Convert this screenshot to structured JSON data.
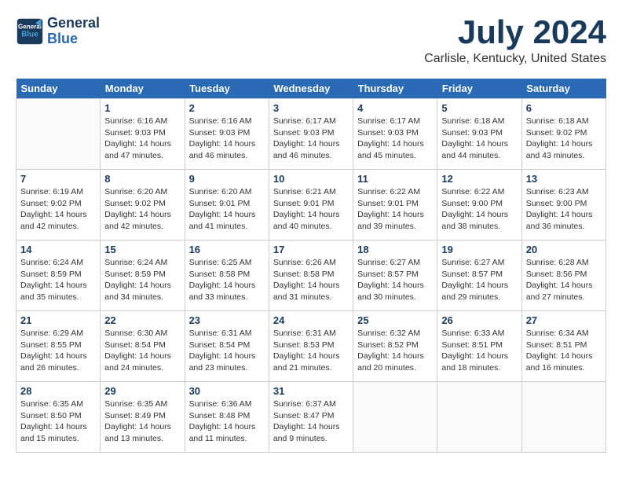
{
  "header": {
    "logo_line1": "General",
    "logo_line2": "Blue",
    "month_title": "July 2024",
    "location": "Carlisle, Kentucky, United States"
  },
  "days_of_week": [
    "Sunday",
    "Monday",
    "Tuesday",
    "Wednesday",
    "Thursday",
    "Friday",
    "Saturday"
  ],
  "weeks": [
    [
      {
        "date": "",
        "sunrise": "",
        "sunset": "",
        "daylight": ""
      },
      {
        "date": "1",
        "sunrise": "Sunrise: 6:16 AM",
        "sunset": "Sunset: 9:03 PM",
        "daylight": "Daylight: 14 hours and 47 minutes."
      },
      {
        "date": "2",
        "sunrise": "Sunrise: 6:16 AM",
        "sunset": "Sunset: 9:03 PM",
        "daylight": "Daylight: 14 hours and 46 minutes."
      },
      {
        "date": "3",
        "sunrise": "Sunrise: 6:17 AM",
        "sunset": "Sunset: 9:03 PM",
        "daylight": "Daylight: 14 hours and 46 minutes."
      },
      {
        "date": "4",
        "sunrise": "Sunrise: 6:17 AM",
        "sunset": "Sunset: 9:03 PM",
        "daylight": "Daylight: 14 hours and 45 minutes."
      },
      {
        "date": "5",
        "sunrise": "Sunrise: 6:18 AM",
        "sunset": "Sunset: 9:03 PM",
        "daylight": "Daylight: 14 hours and 44 minutes."
      },
      {
        "date": "6",
        "sunrise": "Sunrise: 6:18 AM",
        "sunset": "Sunset: 9:02 PM",
        "daylight": "Daylight: 14 hours and 43 minutes."
      }
    ],
    [
      {
        "date": "7",
        "sunrise": "Sunrise: 6:19 AM",
        "sunset": "Sunset: 9:02 PM",
        "daylight": "Daylight: 14 hours and 42 minutes."
      },
      {
        "date": "8",
        "sunrise": "Sunrise: 6:20 AM",
        "sunset": "Sunset: 9:02 PM",
        "daylight": "Daylight: 14 hours and 42 minutes."
      },
      {
        "date": "9",
        "sunrise": "Sunrise: 6:20 AM",
        "sunset": "Sunset: 9:01 PM",
        "daylight": "Daylight: 14 hours and 41 minutes."
      },
      {
        "date": "10",
        "sunrise": "Sunrise: 6:21 AM",
        "sunset": "Sunset: 9:01 PM",
        "daylight": "Daylight: 14 hours and 40 minutes."
      },
      {
        "date": "11",
        "sunrise": "Sunrise: 6:22 AM",
        "sunset": "Sunset: 9:01 PM",
        "daylight": "Daylight: 14 hours and 39 minutes."
      },
      {
        "date": "12",
        "sunrise": "Sunrise: 6:22 AM",
        "sunset": "Sunset: 9:00 PM",
        "daylight": "Daylight: 14 hours and 38 minutes."
      },
      {
        "date": "13",
        "sunrise": "Sunrise: 6:23 AM",
        "sunset": "Sunset: 9:00 PM",
        "daylight": "Daylight: 14 hours and 36 minutes."
      }
    ],
    [
      {
        "date": "14",
        "sunrise": "Sunrise: 6:24 AM",
        "sunset": "Sunset: 8:59 PM",
        "daylight": "Daylight: 14 hours and 35 minutes."
      },
      {
        "date": "15",
        "sunrise": "Sunrise: 6:24 AM",
        "sunset": "Sunset: 8:59 PM",
        "daylight": "Daylight: 14 hours and 34 minutes."
      },
      {
        "date": "16",
        "sunrise": "Sunrise: 6:25 AM",
        "sunset": "Sunset: 8:58 PM",
        "daylight": "Daylight: 14 hours and 33 minutes."
      },
      {
        "date": "17",
        "sunrise": "Sunrise: 6:26 AM",
        "sunset": "Sunset: 8:58 PM",
        "daylight": "Daylight: 14 hours and 31 minutes."
      },
      {
        "date": "18",
        "sunrise": "Sunrise: 6:27 AM",
        "sunset": "Sunset: 8:57 PM",
        "daylight": "Daylight: 14 hours and 30 minutes."
      },
      {
        "date": "19",
        "sunrise": "Sunrise: 6:27 AM",
        "sunset": "Sunset: 8:57 PM",
        "daylight": "Daylight: 14 hours and 29 minutes."
      },
      {
        "date": "20",
        "sunrise": "Sunrise: 6:28 AM",
        "sunset": "Sunset: 8:56 PM",
        "daylight": "Daylight: 14 hours and 27 minutes."
      }
    ],
    [
      {
        "date": "21",
        "sunrise": "Sunrise: 6:29 AM",
        "sunset": "Sunset: 8:55 PM",
        "daylight": "Daylight: 14 hours and 26 minutes."
      },
      {
        "date": "22",
        "sunrise": "Sunrise: 6:30 AM",
        "sunset": "Sunset: 8:54 PM",
        "daylight": "Daylight: 14 hours and 24 minutes."
      },
      {
        "date": "23",
        "sunrise": "Sunrise: 6:31 AM",
        "sunset": "Sunset: 8:54 PM",
        "daylight": "Daylight: 14 hours and 23 minutes."
      },
      {
        "date": "24",
        "sunrise": "Sunrise: 6:31 AM",
        "sunset": "Sunset: 8:53 PM",
        "daylight": "Daylight: 14 hours and 21 minutes."
      },
      {
        "date": "25",
        "sunrise": "Sunrise: 6:32 AM",
        "sunset": "Sunset: 8:52 PM",
        "daylight": "Daylight: 14 hours and 20 minutes."
      },
      {
        "date": "26",
        "sunrise": "Sunrise: 6:33 AM",
        "sunset": "Sunset: 8:51 PM",
        "daylight": "Daylight: 14 hours and 18 minutes."
      },
      {
        "date": "27",
        "sunrise": "Sunrise: 6:34 AM",
        "sunset": "Sunset: 8:51 PM",
        "daylight": "Daylight: 14 hours and 16 minutes."
      }
    ],
    [
      {
        "date": "28",
        "sunrise": "Sunrise: 6:35 AM",
        "sunset": "Sunset: 8:50 PM",
        "daylight": "Daylight: 14 hours and 15 minutes."
      },
      {
        "date": "29",
        "sunrise": "Sunrise: 6:35 AM",
        "sunset": "Sunset: 8:49 PM",
        "daylight": "Daylight: 14 hours and 13 minutes."
      },
      {
        "date": "30",
        "sunrise": "Sunrise: 6:36 AM",
        "sunset": "Sunset: 8:48 PM",
        "daylight": "Daylight: 14 hours and 11 minutes."
      },
      {
        "date": "31",
        "sunrise": "Sunrise: 6:37 AM",
        "sunset": "Sunset: 8:47 PM",
        "daylight": "Daylight: 14 hours and 9 minutes."
      },
      {
        "date": "",
        "sunrise": "",
        "sunset": "",
        "daylight": ""
      },
      {
        "date": "",
        "sunrise": "",
        "sunset": "",
        "daylight": ""
      },
      {
        "date": "",
        "sunrise": "",
        "sunset": "",
        "daylight": ""
      }
    ]
  ]
}
